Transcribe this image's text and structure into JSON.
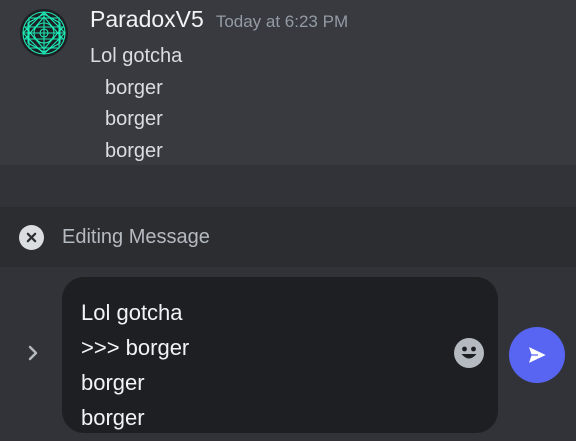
{
  "message": {
    "username": "ParadoxV5",
    "timestamp": "Today at 6:23 PM",
    "first_line": "Lol gotcha",
    "quoted_lines": [
      "borger",
      "borger",
      "borger"
    ],
    "avatar_icon": "geometric-avatar-icon"
  },
  "edit_bar": {
    "label": "Editing Message",
    "close_icon": "close-circle-icon"
  },
  "composer": {
    "value": "Lol gotcha\n>>> borger\nborger\nborger",
    "expand_icon": "chevron-right-icon",
    "emoji_icon": "smiley-icon",
    "send_icon": "paper-plane-icon"
  },
  "colors": {
    "accent": "#5865f2",
    "avatar": "#1de9b6",
    "message_bg": "#383a40",
    "input_bg": "#1e1f22"
  }
}
